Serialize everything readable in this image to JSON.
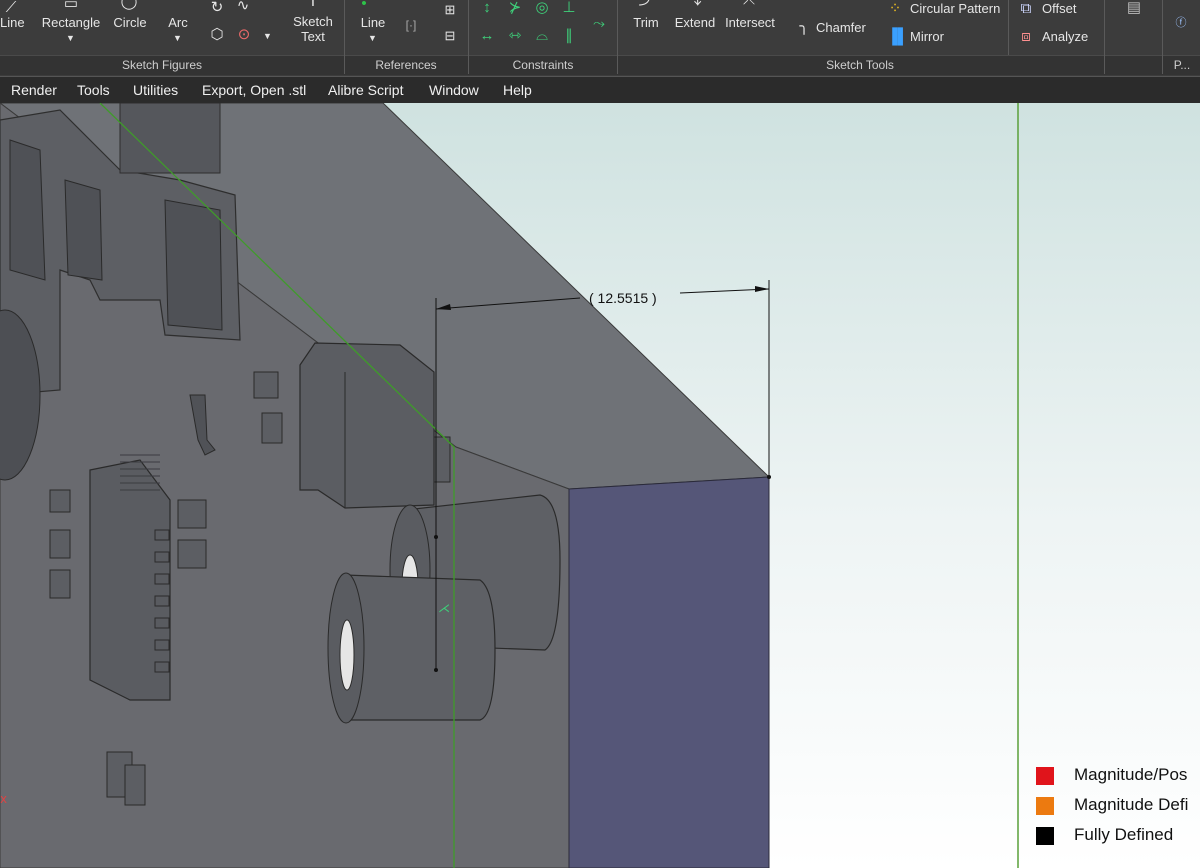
{
  "ribbon": {
    "sketch_figures": {
      "group_label": "Sketch Figures",
      "line_label": "Line",
      "rectangle_label": "Rectangle",
      "circle_label": "Circle",
      "arc_label": "Arc",
      "sketch_text_line1": "Sketch",
      "sketch_text_line2": "Text"
    },
    "references": {
      "group_label": "References",
      "line_label": "Line"
    },
    "constraints": {
      "group_label": "Constraints"
    },
    "sketch_tools": {
      "group_label": "Sketch Tools",
      "trim_label": "Trim",
      "extend_label": "Extend",
      "intersect_label": "Intersect",
      "chamfer_label": "Chamfer",
      "circular_pattern_label": "Circular Pattern",
      "mirror_label": "Mirror",
      "offset_label": "Offset",
      "analyze_label": "Analyze"
    },
    "last_group_label": "P..."
  },
  "menu": [
    "Render",
    "Tools",
    "Utilities",
    "Export, Open .stl",
    "Alibre Script",
    "Window",
    "Help"
  ],
  "viewport": {
    "dimension_label": "( 12.5515 )"
  },
  "legend": [
    {
      "label": "Magnitude/Pos",
      "color": "#e0141b"
    },
    {
      "label": "Magnitude Defi",
      "color": "#ec7a10"
    },
    {
      "label": "Fully Defined",
      "color": "#000000"
    }
  ]
}
